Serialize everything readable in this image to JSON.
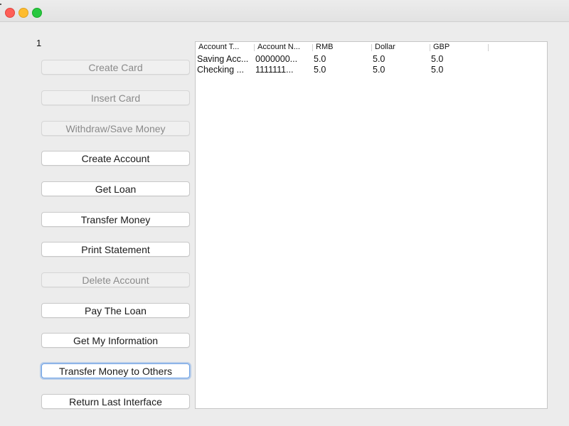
{
  "user_label": "1",
  "buttons": [
    {
      "label": "Create Card",
      "enabled": false
    },
    {
      "label": "Insert Card",
      "enabled": false
    },
    {
      "label": "Withdraw/Save Money",
      "enabled": false
    },
    {
      "label": "Create Account",
      "enabled": true
    },
    {
      "label": "Get Loan",
      "enabled": true
    },
    {
      "label": "Transfer Money",
      "enabled": true
    },
    {
      "label": "Print Statement",
      "enabled": true
    },
    {
      "label": "Delete Account",
      "enabled": false
    },
    {
      "label": "Pay The Loan",
      "enabled": true
    },
    {
      "label": "Get My Information",
      "enabled": true
    },
    {
      "label": "Transfer Money to Others",
      "enabled": true
    },
    {
      "label": "Return Last Interface",
      "enabled": true
    }
  ],
  "table": {
    "columns": [
      "Account T...",
      "Account N...",
      "RMB",
      "Dollar",
      "GBP",
      ""
    ],
    "rows": [
      [
        "Saving Acc...",
        "0000000...",
        "5.0",
        "5.0",
        "5.0",
        ""
      ],
      [
        "Checking ...",
        "1111111...",
        "5.0",
        "5.0",
        "5.0",
        ""
      ]
    ]
  }
}
